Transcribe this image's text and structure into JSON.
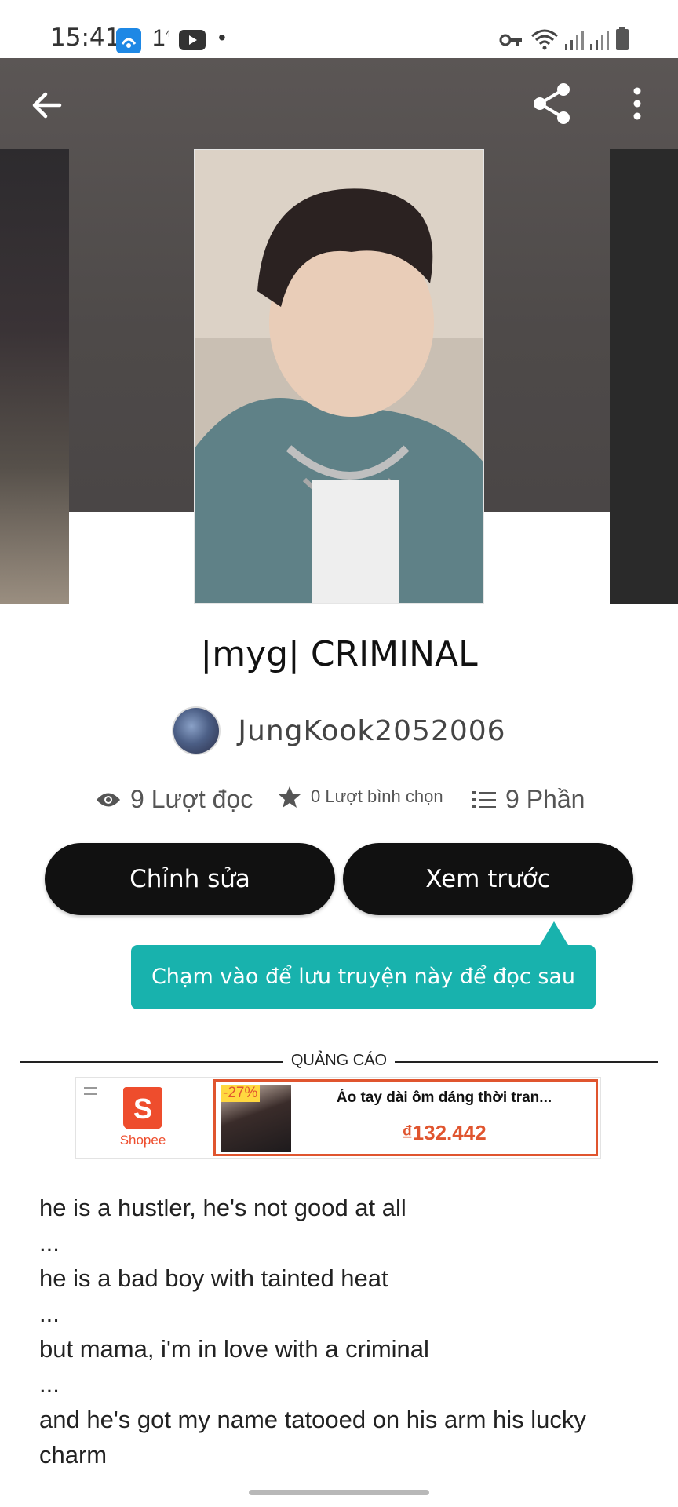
{
  "status_bar": {
    "time": "15:41",
    "notification_count": "1",
    "notification_sup": "4",
    "dot": "•",
    "icons": [
      "wifi-calling-icon",
      "youtube-icon",
      "vpn-key-icon",
      "wifi-icon",
      "signal-icon",
      "signal-icon",
      "battery-icon"
    ]
  },
  "header": {
    "back_icon": "arrow-left-icon",
    "share_icon": "share-icon",
    "more_icon": "more-vertical-icon"
  },
  "story": {
    "title": "|myg| CRIMINAL",
    "author": "JungKook2052006",
    "stats": {
      "reads": "9 Lượt đọc",
      "votes": "0 Lượt bình chọn",
      "parts": "9 Phần"
    }
  },
  "actions": {
    "edit_label": "Chỉnh sửa",
    "preview_label": "Xem trước"
  },
  "tooltip": {
    "text": "Chạm vào để lưu truyện này để đọc sau"
  },
  "ad": {
    "label": "QUẢNG CÁO",
    "brand": "Shopee",
    "brand_glyph": "S",
    "discount": "-27%",
    "product_title": "Áo tay dài ôm dáng thời tran...",
    "price": "₫132.442",
    "accent_color": "#ee4d2d"
  },
  "description": {
    "lines": [
      "he is a hustler, he's not good at all",
      "...",
      "he is a bad boy with tainted heat",
      "...",
      "but mama, i'm in love with a criminal",
      "...",
      "and he's got my name tatooed on his arm his lucky",
      "charm"
    ]
  },
  "colors": {
    "tooltip_bg": "#18b2ad",
    "button_bg": "#111111"
  }
}
